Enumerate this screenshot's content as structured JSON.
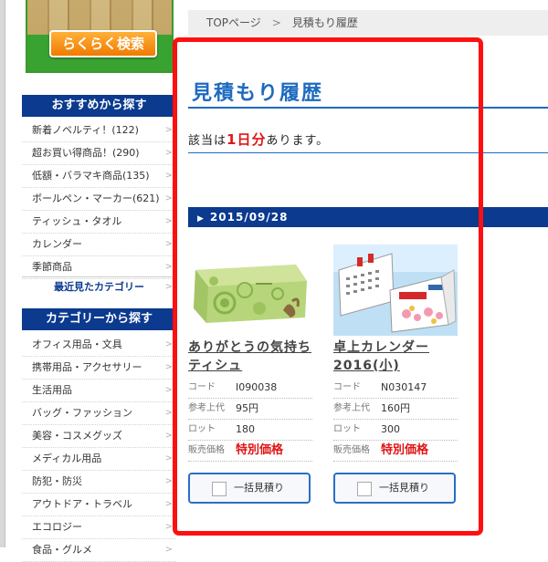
{
  "sidebar": {
    "search_button": "らくらく検索",
    "recommend_header": "おすすめから探す",
    "recommend_items": [
      {
        "label": "新着ノベルティ！(122)"
      },
      {
        "label": "超お買い得商品！(290)"
      },
      {
        "label": "低額・バラマキ商品(135)"
      },
      {
        "label": "ボールペン・マーカー(621)"
      },
      {
        "label": "ティッシュ・タオル"
      },
      {
        "label": "カレンダー"
      },
      {
        "label": "季節商品"
      }
    ],
    "recent_categories": "最近見たカテゴリー",
    "category_header": "カテゴリーから探す",
    "category_items": [
      {
        "label": "オフィス用品・文具"
      },
      {
        "label": "携帯用品・アクセサリー"
      },
      {
        "label": "生活用品"
      },
      {
        "label": "バッグ・ファッション"
      },
      {
        "label": "美容・コスメグッズ"
      },
      {
        "label": "メディカル用品"
      },
      {
        "label": "防犯・防災"
      },
      {
        "label": "アウトドア・トラベル"
      },
      {
        "label": "エコロジー"
      },
      {
        "label": "食品・グルメ"
      }
    ]
  },
  "breadcrumb": {
    "home": "TOPページ",
    "separator": ">",
    "current": "見積もり履歴"
  },
  "main": {
    "title": "見積もり履歴",
    "result_prefix": "該当は",
    "result_count": "1日分",
    "result_suffix": "あります。",
    "date": "2015/09/28",
    "products": [
      {
        "name": "ありがとうの気持ち ティシュ",
        "specs": [
          {
            "key": "コード",
            "value": "I090038"
          },
          {
            "key": "参考上代",
            "value": "95円"
          },
          {
            "key": "ロット",
            "value": "180"
          },
          {
            "key": "販売価格",
            "value": "特別価格"
          }
        ],
        "quote_label": "一括見積り"
      },
      {
        "name": "卓上カレンダー2016(小)",
        "specs": [
          {
            "key": "コード",
            "value": "N030147"
          },
          {
            "key": "参考上代",
            "value": "160円"
          },
          {
            "key": "ロット",
            "value": "300"
          },
          {
            "key": "販売価格",
            "value": "特別価格"
          }
        ],
        "quote_label": "一括見積り"
      }
    ]
  },
  "colors": {
    "nav_blue": "#0b3a8f",
    "title_blue": "#1e6ac0",
    "accent_red": "#e01515",
    "highlight_red": "#ff1010",
    "button_orange": "#f07a00"
  }
}
